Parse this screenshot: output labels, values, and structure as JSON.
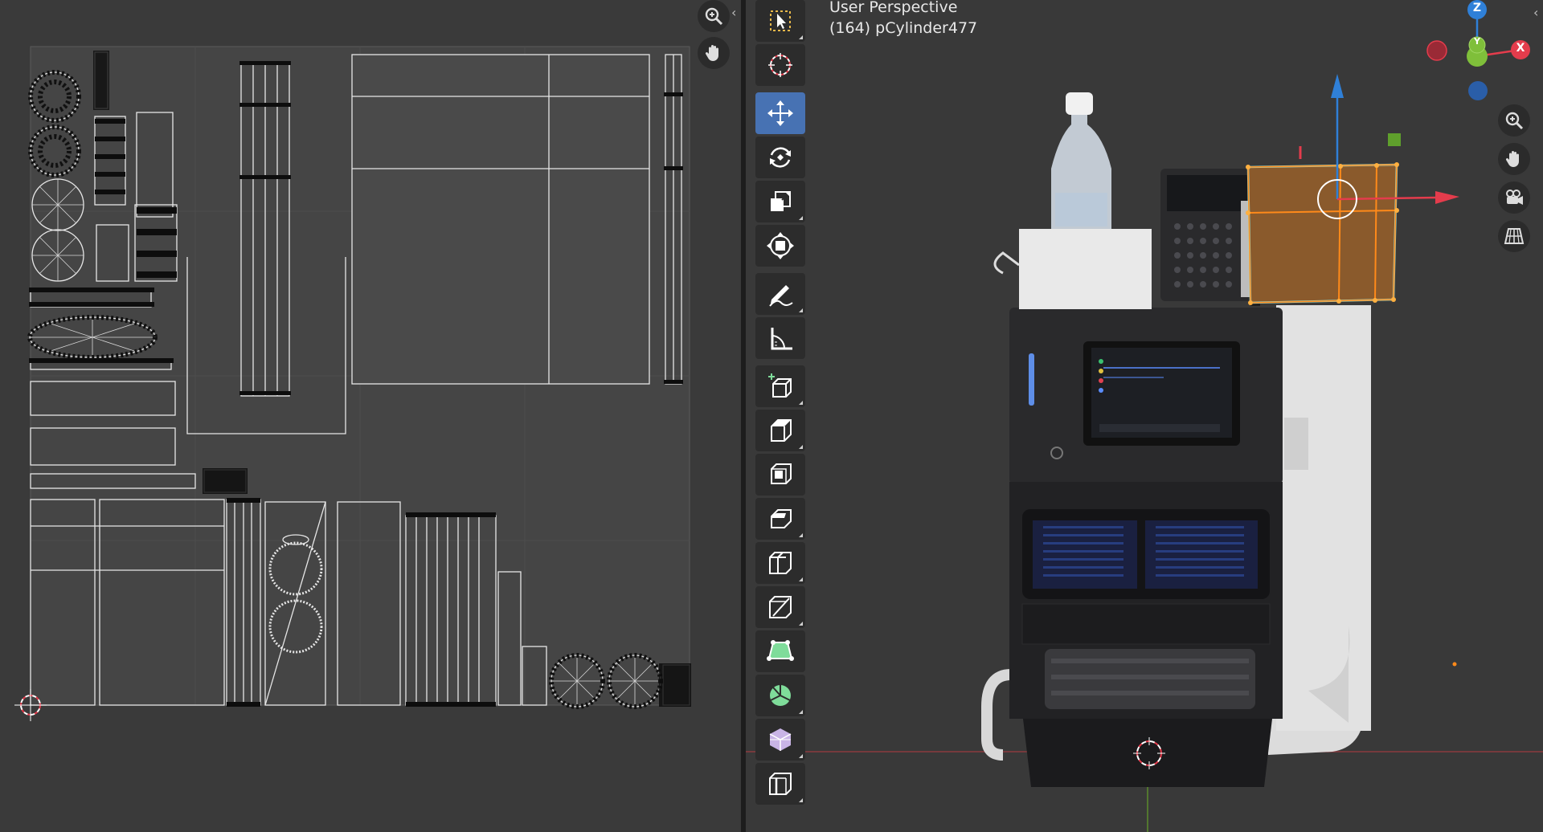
{
  "viewport": {
    "mode_title": "User Perspective",
    "object_label": "(164) pCylinder477"
  },
  "gizmo": {
    "z": "Z",
    "y": "Y",
    "x": "X"
  },
  "uv_nav": [
    "zoom-icon",
    "hand-icon"
  ],
  "viewport_nav": [
    "zoom-icon",
    "hand-icon",
    "camera-icon",
    "grid-icon"
  ],
  "tools": [
    {
      "name": "select-box"
    },
    {
      "name": "cursor"
    },
    {
      "name": "move",
      "active": true
    },
    {
      "name": "rotate"
    },
    {
      "name": "scale"
    },
    {
      "name": "transform"
    },
    {
      "name": "annotate"
    },
    {
      "name": "measure"
    },
    {
      "name": "add-cube"
    },
    {
      "name": "extrude-region"
    },
    {
      "name": "inset-faces"
    },
    {
      "name": "bevel"
    },
    {
      "name": "loop-cut"
    },
    {
      "name": "knife"
    },
    {
      "name": "poly-build"
    },
    {
      "name": "spin"
    },
    {
      "name": "smooth"
    },
    {
      "name": "edge-slide"
    }
  ],
  "colors": {
    "active_tool": "#4772b3",
    "x_axis": "#e43c4c",
    "y_axis": "#7fbf3a",
    "z_axis": "#2f80d8",
    "selection": "#ff8a1a"
  }
}
